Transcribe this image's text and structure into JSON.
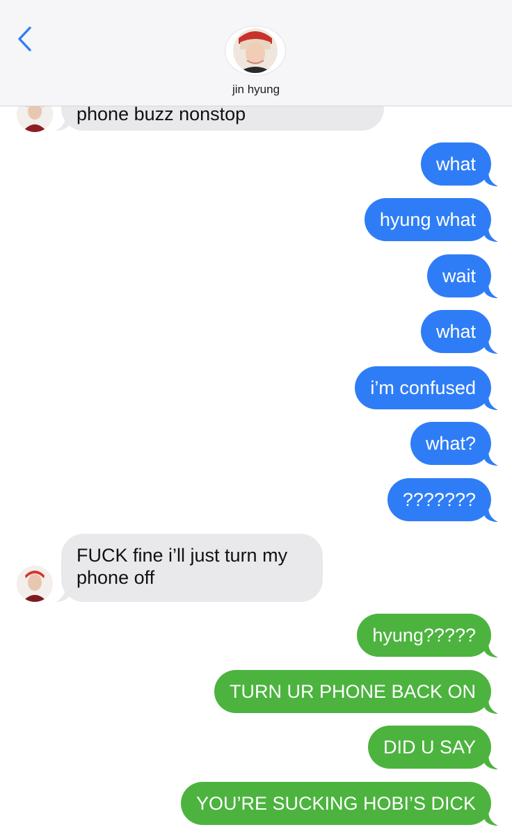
{
  "header": {
    "back_label": "<",
    "contact_name": "jin hyung",
    "back_icon": "chevron-left-icon",
    "contact_avatar": "contact-photo"
  },
  "colors": {
    "imessage_blue": "#2f7df6",
    "sms_green": "#4cb33f",
    "incoming_gray": "#e9e9ec",
    "link_blue": "#2f7df6"
  },
  "messages": [
    {
      "direction": "incoming",
      "text": "phone buzz nonstop"
    },
    {
      "direction": "outgoing",
      "service": "imessage",
      "text": "what"
    },
    {
      "direction": "outgoing",
      "service": "imessage",
      "text": "hyung what"
    },
    {
      "direction": "outgoing",
      "service": "imessage",
      "text": "wait"
    },
    {
      "direction": "outgoing",
      "service": "imessage",
      "text": "what"
    },
    {
      "direction": "outgoing",
      "service": "imessage",
      "text": "i’m confused"
    },
    {
      "direction": "outgoing",
      "service": "imessage",
      "text": "what?"
    },
    {
      "direction": "outgoing",
      "service": "imessage",
      "text": "???????"
    },
    {
      "direction": "incoming",
      "text": "FUCK fine i’ll just turn my phone off"
    },
    {
      "direction": "outgoing",
      "service": "sms",
      "text": "hyung?????"
    },
    {
      "direction": "outgoing",
      "service": "sms",
      "text": "TURN UR PHONE BACK ON"
    },
    {
      "direction": "outgoing",
      "service": "sms",
      "text": "DID U SAY"
    },
    {
      "direction": "outgoing",
      "service": "sms",
      "text": "YOU’RE SUCKING HOBI’S DICK"
    }
  ]
}
